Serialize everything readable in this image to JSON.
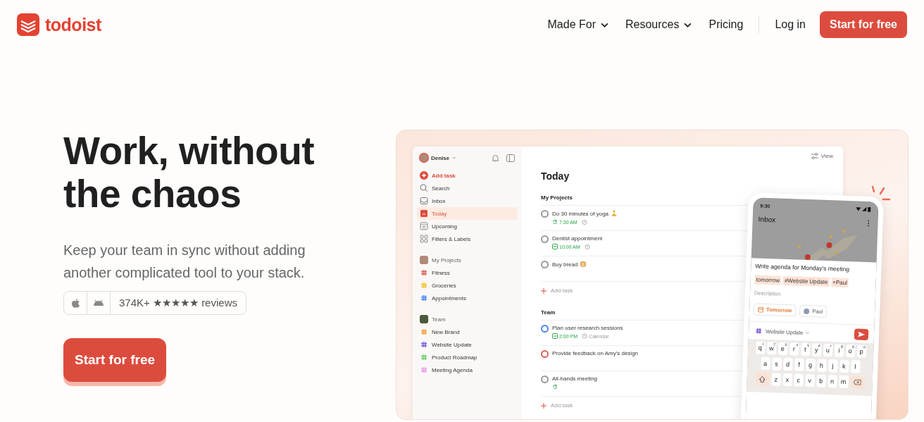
{
  "header": {
    "logo": "todoist",
    "nav": [
      {
        "label": "Made For",
        "dropdown": true
      },
      {
        "label": "Resources",
        "dropdown": true
      },
      {
        "label": "Pricing",
        "dropdown": false
      }
    ],
    "login": "Log in",
    "cta": "Start for free"
  },
  "hero": {
    "title": "Work, without the chaos",
    "subtitle": "Keep your team in sync without adding another complicated tool to your stack.",
    "rating": "374K+ ★★★★★ reviews",
    "cta": "Start for free"
  },
  "app": {
    "user": "Denise",
    "nav": [
      {
        "label": "Add task",
        "kind": "add",
        "selected": false
      },
      {
        "label": "Search",
        "kind": "search",
        "selected": false
      },
      {
        "label": "Inbox",
        "kind": "inbox",
        "selected": false
      },
      {
        "label": "Today",
        "kind": "today",
        "selected": true
      },
      {
        "label": "Upcoming",
        "kind": "upcoming",
        "selected": false
      },
      {
        "label": "Filters & Labels",
        "kind": "filters",
        "selected": false
      }
    ],
    "groups": [
      {
        "name": "My Projects",
        "kind": "personal",
        "projects": [
          {
            "name": "Fitness",
            "color": "#e0605a"
          },
          {
            "name": "Groceries",
            "color": "#f2c230"
          },
          {
            "name": "Appointments",
            "color": "#4f86ef"
          }
        ]
      },
      {
        "name": "Team",
        "kind": "team",
        "projects": [
          {
            "name": "New Brand",
            "color": "#f5a03c"
          },
          {
            "name": "Website Update",
            "color": "#7f5bd6"
          },
          {
            "name": "Product Roadmap",
            "color": "#6fcf6b"
          },
          {
            "name": "Meeting Agenda",
            "color": "#e99be6"
          }
        ]
      }
    ],
    "view": "View",
    "title": "Today",
    "sections": [
      {
        "name": "My Projects",
        "add": "Add task",
        "tasks": [
          {
            "title": "Do 30 minutes of yoga",
            "kind": "yoga",
            "color": "#9a9a9a",
            "meta": [
              {
                "kind": "recurring",
                "text": "7:30 AM"
              },
              {
                "kind": "alarm"
              }
            ]
          },
          {
            "title": "Dentist appointment",
            "color": "#9a9a9a",
            "meta": [
              {
                "kind": "date",
                "text": "10:00 AM"
              },
              {
                "kind": "alarm"
              }
            ]
          },
          {
            "title": "Buy bread",
            "kind": "bread",
            "color": "#9a9a9a"
          }
        ]
      },
      {
        "name": "Team",
        "add": "Add task",
        "tasks": [
          {
            "title": "Plan user research sessions",
            "color": "#4f86ef",
            "meta": [
              {
                "kind": "date",
                "text": "2:00 PM"
              },
              {
                "kind": "calendar",
                "text": "Calendar"
              }
            ]
          },
          {
            "title": "Provide feedback on Amy's design",
            "color": "#e0605a"
          },
          {
            "title": "All-hands meeting",
            "color": "#9a9a9a",
            "meta": [
              {
                "kind": "recurring"
              }
            ]
          }
        ]
      }
    ]
  },
  "phone": {
    "time": "9:30",
    "title": "Inbox",
    "task": "Write agenda for Monday's meeting",
    "tags": [
      "tomorrow",
      "#Website Update",
      "+Paul"
    ],
    "placeholder": "Description",
    "chips": [
      {
        "label": "Tomorrow",
        "kind": "date"
      },
      {
        "label": "Paul",
        "kind": "person"
      }
    ],
    "project": "Website Update",
    "keys": [
      [
        {
          "key": "q",
          "hint": "1"
        },
        {
          "key": "w",
          "hint": "2"
        },
        {
          "key": "e",
          "hint": "3"
        },
        {
          "key": "r",
          "hint": "4"
        },
        {
          "key": "t",
          "hint": "5"
        },
        {
          "key": "y",
          "hint": "6"
        },
        {
          "key": "u",
          "hint": "7"
        },
        {
          "key": "i",
          "hint": "8"
        },
        {
          "key": "o",
          "hint": "9"
        },
        {
          "key": "p",
          "hint": "0"
        }
      ],
      [
        {
          "key": "a"
        },
        {
          "key": "s"
        },
        {
          "key": "d"
        },
        {
          "key": "f"
        },
        {
          "key": "g"
        },
        {
          "key": "h"
        },
        {
          "key": "j"
        },
        {
          "key": "k"
        },
        {
          "key": "l"
        }
      ],
      [
        {
          "kind": "shift"
        },
        {
          "key": "z"
        },
        {
          "key": "x"
        },
        {
          "key": "c"
        },
        {
          "key": "v"
        },
        {
          "key": "b"
        },
        {
          "key": "n"
        },
        {
          "key": "m"
        },
        {
          "kind": "backspace"
        }
      ]
    ]
  }
}
